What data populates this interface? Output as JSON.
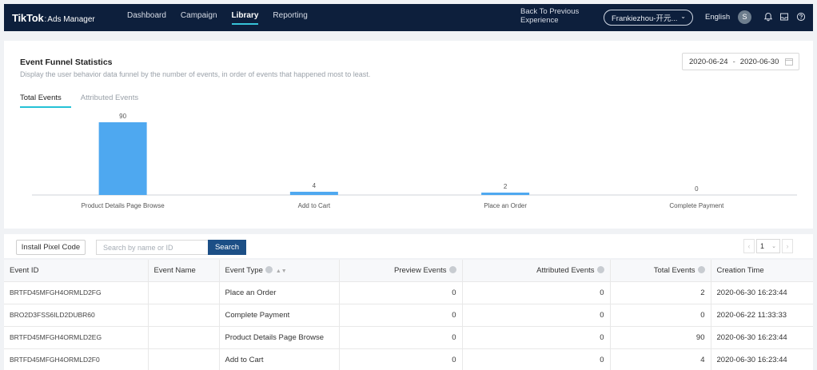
{
  "topbar": {
    "brand": "TikTok",
    "product": "Ads Manager",
    "nav": [
      "Dashboard",
      "Campaign",
      "Library",
      "Reporting"
    ],
    "active_nav": "Library",
    "back_link": "Back To Previous Experience",
    "account": "Frankiezhou-开元...",
    "language": "English",
    "avatar_initial": "S"
  },
  "funnel": {
    "title": "Event Funnel Statistics",
    "description": "Display the user behavior data funnel by the number of events, in order of events that happened most to least.",
    "date_start": "2020-06-24",
    "date_sep": "-",
    "date_end": "2020-06-30",
    "tabs": [
      "Total Events",
      "Attributed Events"
    ],
    "active_tab": "Total Events"
  },
  "chart_data": {
    "type": "bar",
    "categories": [
      "Product Details Page Browse",
      "Add to Cart",
      "Place an Order",
      "Complete Payment"
    ],
    "values": [
      90,
      4,
      2,
      0
    ],
    "ylim": [
      0,
      90
    ],
    "grid": false,
    "bar_color": "#4ea8f0"
  },
  "toolbar": {
    "install_label": "Install Pixel Code",
    "search_placeholder": "Search by name or ID",
    "search_label": "Search",
    "page": "1"
  },
  "table": {
    "headers": [
      "Event ID",
      "Event Name",
      "Event Type",
      "Preview Events",
      "Attributed Events",
      "Total Events",
      "Creation Time"
    ],
    "rows": [
      [
        "BRTFD45MFGH4ORMLD2FG",
        "",
        "Place an Order",
        "0",
        "0",
        "2",
        "2020-06-30 16:23:44"
      ],
      [
        "BRO2D3FSS6ILD2DUBR60",
        "",
        "Complete Payment",
        "0",
        "0",
        "0",
        "2020-06-22 11:33:33"
      ],
      [
        "BRTFD45MFGH4ORMLD2EG",
        "",
        "Product Details Page Browse",
        "0",
        "0",
        "90",
        "2020-06-30 16:23:44"
      ],
      [
        "BRTFD45MFGH4ORMLD2F0",
        "",
        "Add to Cart",
        "0",
        "0",
        "4",
        "2020-06-30 16:23:44"
      ]
    ]
  },
  "colors": {
    "nav_bg": "#0d1f3c",
    "accent": "#25c2d6",
    "primary_button": "#1c4f86"
  }
}
